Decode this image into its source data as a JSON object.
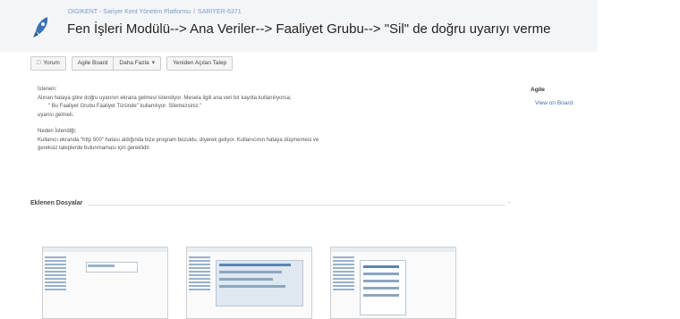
{
  "header": {
    "breadcrumb_project": "DIGIKENT - Sariyer Kent Yönetim Platformu",
    "breadcrumb_sep": "/",
    "breadcrumb_issue": "SARIYER-6371",
    "title": "Fen İşleri Modülü--> Ana Veriler--> Faaliyet Grubu--> \"Sil\" de doğru uyarıyı verme"
  },
  "toolbar": {
    "comment_label": "Yorum",
    "agile_board_label": "Agile Board",
    "more_label": "Daha Fazla",
    "reopen_label": "Yeniden Açılan Talep"
  },
  "description": {
    "line1": "İstenen:",
    "line2": "Alınan hataya göre doğru uyarının ekrana gelmesi istendiyor. Mesela ilgili ana veri bir kayıtta kullanılıyorsa;",
    "line3": "\" Bu Faaliyet Grubu Faaliyet Türünde\" kullanılıyor. Silemezsiniz.\"",
    "line4": "uyarısı gelmeli.",
    "line5": "Neden İstendiği;",
    "line6": "Kullanıcı ekranda \"http 500\" hatası aldığında bize program bozuldu. diyerek geliyor. Kullanıcının hataya düşmemesi ve",
    "line7": "gereksiz taleplerde bulunmaması için gereklidir."
  },
  "side_panel": {
    "title": "Agile",
    "link": "View on Board"
  },
  "attachments": {
    "heading": "Eklenen Dosyalar",
    "collapse_glyph": "-"
  },
  "colors": {
    "accent": "#3a72b5",
    "header_bg": "#f4f5f7",
    "breadcrumb": "#7a9cc6"
  },
  "icons": [
    "rocket-logo-icon",
    "comment-icon",
    "chevron-down-icon"
  ]
}
